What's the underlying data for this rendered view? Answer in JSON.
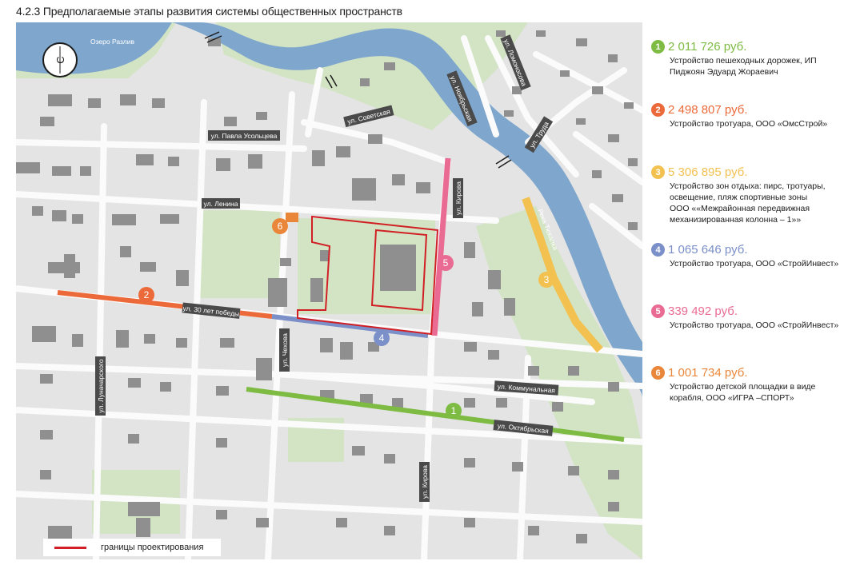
{
  "title": "4.2.3 Предполагаемые этапы развития системы общественных пространств",
  "map": {
    "lake_label": "Озеро Разлив",
    "river_label": "Река Тюкалка",
    "compass_letter": "С",
    "streets": {
      "pavla_usoltseva": "ул. Павла Усольцева",
      "sovetskaya": "ул. Советская",
      "lenina": "ул. Ленина",
      "tridtsat_let_pobedy": "ул. 30 лет победы",
      "chekhova": "ул. Чехова",
      "kirova_north": "ул. Кирова",
      "kirova_south": "ул. Кирова",
      "lunacharskogo": "ул. Луначарского",
      "kommunalnaya": "ул. Коммунальная",
      "oktyabrskaya": "ул. Октябрьская",
      "noyabrskaya": "ул. Ноябрьская",
      "lomonosova": "ул. Ломоносова",
      "truda": "ул. Труда"
    },
    "markers": [
      "1",
      "2",
      "3",
      "4",
      "5",
      "6"
    ],
    "colors": {
      "water": "#7fa6cd",
      "park": "#d2e4c3",
      "land": "#e4e4e4",
      "road": "#fbfbfb",
      "building": "#8f8f8f",
      "boundary": "#d11f25"
    }
  },
  "legend": {
    "label": "границы проектирования",
    "color": "#d11f25"
  },
  "items": [
    {
      "num": "1",
      "color": "#7dbb42",
      "amount": "2 011 726 руб.",
      "desc": [
        "Устройство пешеходных дорожек, ИП",
        "Пиджоян Эдуард Жораевич"
      ]
    },
    {
      "num": "2",
      "color": "#ec6a3a",
      "amount": "2 498 807 руб.",
      "desc": [
        "Устройство тротуара, ООО «ОмсСтрой»"
      ]
    },
    {
      "num": "3",
      "color": "#f2c14f",
      "amount": "5 306 895 руб.",
      "desc": [
        "Устройство зон отдыха: пирс, тротуары,",
        "освещение, пляж спортивные зоны",
        "ООО ««Межрайонная передвижная",
        "механизированная колонна – 1»»"
      ]
    },
    {
      "num": "4",
      "color": "#7b8fc8",
      "amount": "1 065 646 руб.",
      "desc": [
        "Устройство тротуара, ООО «СтройИнвест»"
      ]
    },
    {
      "num": "5",
      "color": "#e96b93",
      "amount": "339 492 руб.",
      "desc": [
        "Устройство тротуара, ООО «СтройИнвест»"
      ]
    },
    {
      "num": "6",
      "color": "#e9863a",
      "amount": "1 001 734 руб.",
      "desc": [
        "Устройство детской площадки в виде",
        "корабля, ООО «ИГРА –СПОРТ»"
      ]
    }
  ]
}
